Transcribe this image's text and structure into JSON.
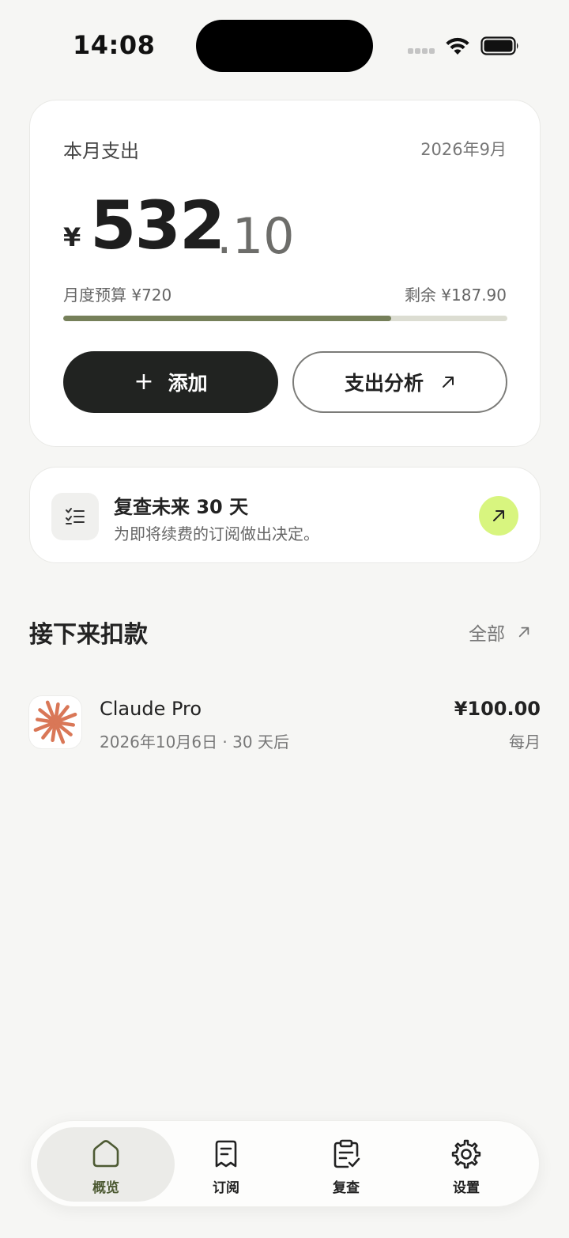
{
  "status_bar": {
    "time": "14:08"
  },
  "summary": {
    "title": "本月支出",
    "date": "2026年9月",
    "currency": "¥",
    "amount_integer": "532",
    "amount_decimal": ".10",
    "budget_label": "月度预算 ¥720",
    "remaining_label": "剩余 ¥187.90",
    "budget_used_fraction": 0.739,
    "add_button": "添加",
    "analysis_button": "支出分析"
  },
  "review": {
    "title": "复查未来 30 天",
    "subtitle": "为即将续费的订阅做出决定。",
    "accent_color": "#d8f57f"
  },
  "upcoming": {
    "title": "接下来扣款",
    "see_all": "全部",
    "items": [
      {
        "name": "Claude Pro",
        "meta": "2026年10月6日 · 30 天后",
        "price": "¥100.00",
        "cycle": "每月",
        "logo_icon": "claude-sunburst-icon",
        "logo_color": "#d97757"
      }
    ]
  },
  "tab_bar": {
    "tabs": [
      {
        "label": "概览",
        "icon": "home-icon",
        "active": true
      },
      {
        "label": "订阅",
        "icon": "receipt-icon",
        "active": false
      },
      {
        "label": "复查",
        "icon": "clipboard-check-icon",
        "active": false
      },
      {
        "label": "设置",
        "icon": "gear-icon",
        "active": false
      }
    ],
    "active_color": "#4d5a33"
  }
}
